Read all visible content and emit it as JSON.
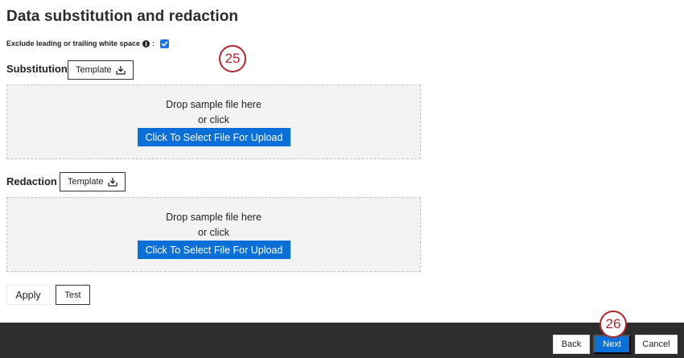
{
  "page": {
    "title": "Data substitution and redaction"
  },
  "whitespace_option": {
    "label": "Exclude leading or trailing white space",
    "suffix": ":",
    "info_glyph": "i",
    "checked": true
  },
  "callouts": {
    "first": "25",
    "second": "26"
  },
  "substitution": {
    "label": "Substitution",
    "template_label": "Template",
    "drop_text": "Drop sample file here",
    "or_text": "or click",
    "upload_label": "Click To Select File For Upload"
  },
  "redaction": {
    "label": "Redaction",
    "template_label": "Template",
    "drop_text": "Drop sample file here",
    "or_text": "or click",
    "upload_label": "Click To Select File For Upload"
  },
  "actions": {
    "apply_label": "Apply",
    "test_label": "Test"
  },
  "footer": {
    "back_label": "Back",
    "next_label": "Next",
    "cancel_label": "Cancel"
  },
  "colors": {
    "accent_blue": "#0a6fd6",
    "checkbox_blue": "#1d74e8",
    "callout_red": "#b3262d",
    "footer_bg": "#2d2d2d",
    "dropzone_bg": "#f3f3f3"
  },
  "icons": {
    "template_download": "download-tray-icon",
    "info": "info-icon",
    "checkbox": "checkmark-icon"
  }
}
